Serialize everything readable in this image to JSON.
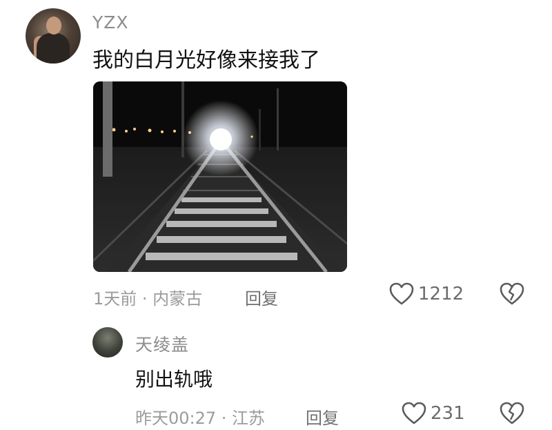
{
  "comment": {
    "username": "YZX",
    "text": "我的白月光好像来接我了",
    "meta": "1天前 · 内蒙古",
    "reply_label": "回复",
    "likes": "1212"
  },
  "reply": {
    "username": "天绫盖",
    "text": "别出轨哦",
    "meta": "昨天00:27 · 江苏",
    "reply_label": "回复",
    "likes": "231"
  },
  "icons": {
    "like": "heart-outline-icon",
    "dislike": "broken-heart-icon"
  },
  "colors": {
    "username": "#8c8c8c",
    "meta": "#9b9b9b",
    "icon": "#5a5a5a"
  }
}
